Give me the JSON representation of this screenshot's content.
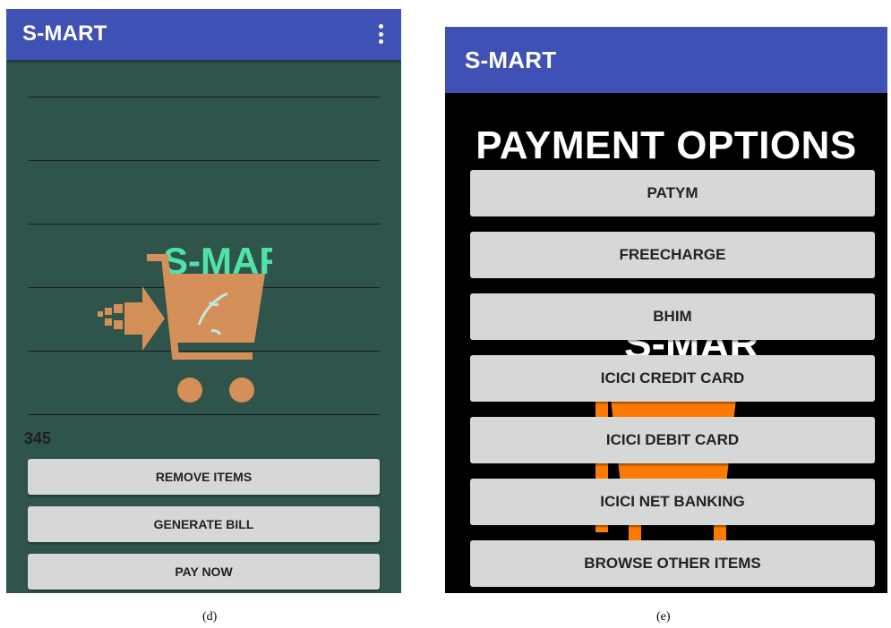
{
  "screen_d": {
    "app_title": "S-MART",
    "logo_text": "S-MART",
    "total": "345",
    "buttons": [
      "REMOVE ITEMS",
      "GENERATE BILL",
      "PAY NOW"
    ],
    "caption": "(d)"
  },
  "screen_e": {
    "app_title": "S-MART",
    "heading": "PAYMENT OPTIONS",
    "logo_text": "S-MART",
    "options": [
      "PATYM",
      "FREECHARGE",
      "BHIM",
      "ICICI CREDIT CARD",
      "ICICI DEBIT CARD",
      "ICICI NET BANKING",
      "BROWSE OTHER ITEMS"
    ],
    "caption": "(e)"
  },
  "colors": {
    "appbar": "#3f51b5",
    "screen_d_background": "#2f544c",
    "screen_e_background": "#000000",
    "logo_text_d": "#4fe3a8",
    "logo_cart_d": "#d58f58",
    "logo_cart_e": "#ff7a00",
    "button": "#d6d7d7"
  }
}
